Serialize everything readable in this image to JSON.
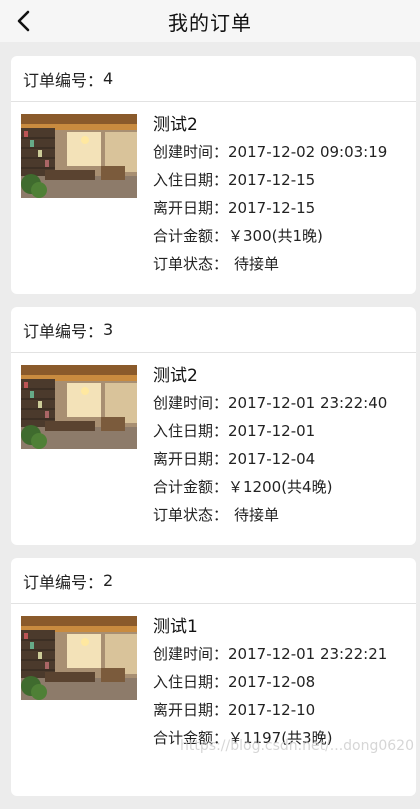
{
  "nav": {
    "title": "我的订单"
  },
  "labels": {
    "order_no": "订单编号：",
    "created": "创建时间：",
    "checkin": "入住日期：",
    "checkout": "离开日期：",
    "total": "合计金额：",
    "status": "订单状态："
  },
  "orders": [
    {
      "number": "4",
      "hotel": "测试2",
      "created": "2017-12-02 09:03:19",
      "checkin": "2017-12-15",
      "checkout": "2017-12-15",
      "total": "￥300(共1晚)",
      "status": "待接单"
    },
    {
      "number": "3",
      "hotel": "测试2",
      "created": "2017-12-01 23:22:40",
      "checkin": "2017-12-01",
      "checkout": "2017-12-04",
      "total": "￥1200(共4晚)",
      "status": "待接单"
    },
    {
      "number": "2",
      "hotel": "测试1",
      "created": "2017-12-01 23:22:21",
      "checkin": "2017-12-08",
      "checkout": "2017-12-10",
      "total": "￥1197(共3晚)",
      "status": ""
    }
  ],
  "watermark": "https://blog.csdn.net/...dong0620"
}
